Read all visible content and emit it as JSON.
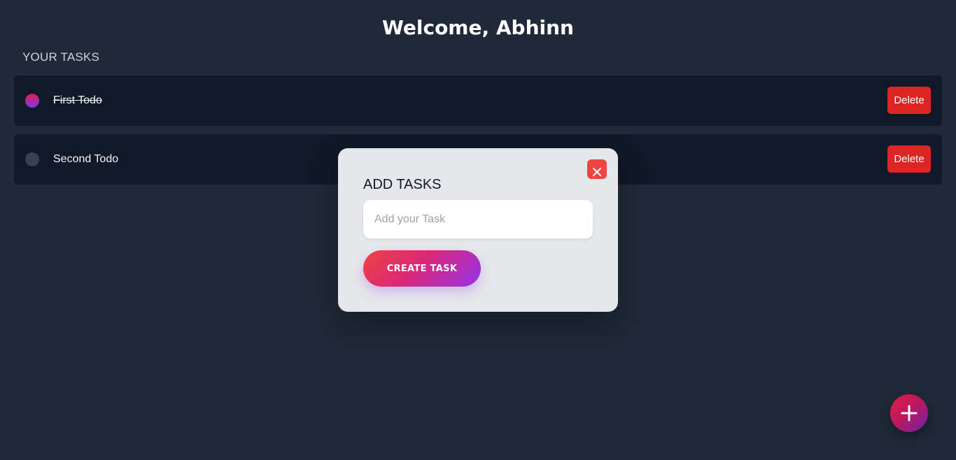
{
  "header": {
    "welcome": "Welcome, Abhinn"
  },
  "tasks_section": {
    "title": "YOUR TASKS",
    "items": [
      {
        "label": "First Todo",
        "completed": true,
        "delete_label": "Delete"
      },
      {
        "label": "Second Todo",
        "completed": false,
        "delete_label": "Delete"
      }
    ]
  },
  "modal": {
    "title": "ADD TASKS",
    "input_value": "",
    "input_placeholder": "Add your Task",
    "create_label": "CREATE TASK",
    "close_icon": "close-icon"
  },
  "fab": {
    "icon": "plus-icon"
  },
  "colors": {
    "background": "#1f2937",
    "task_card": "#111827",
    "delete": "#dc2626",
    "modal": "#e5e7eb",
    "close": "#ef4444",
    "accent_start": "#e11d48",
    "accent_end": "#7c3aed"
  }
}
